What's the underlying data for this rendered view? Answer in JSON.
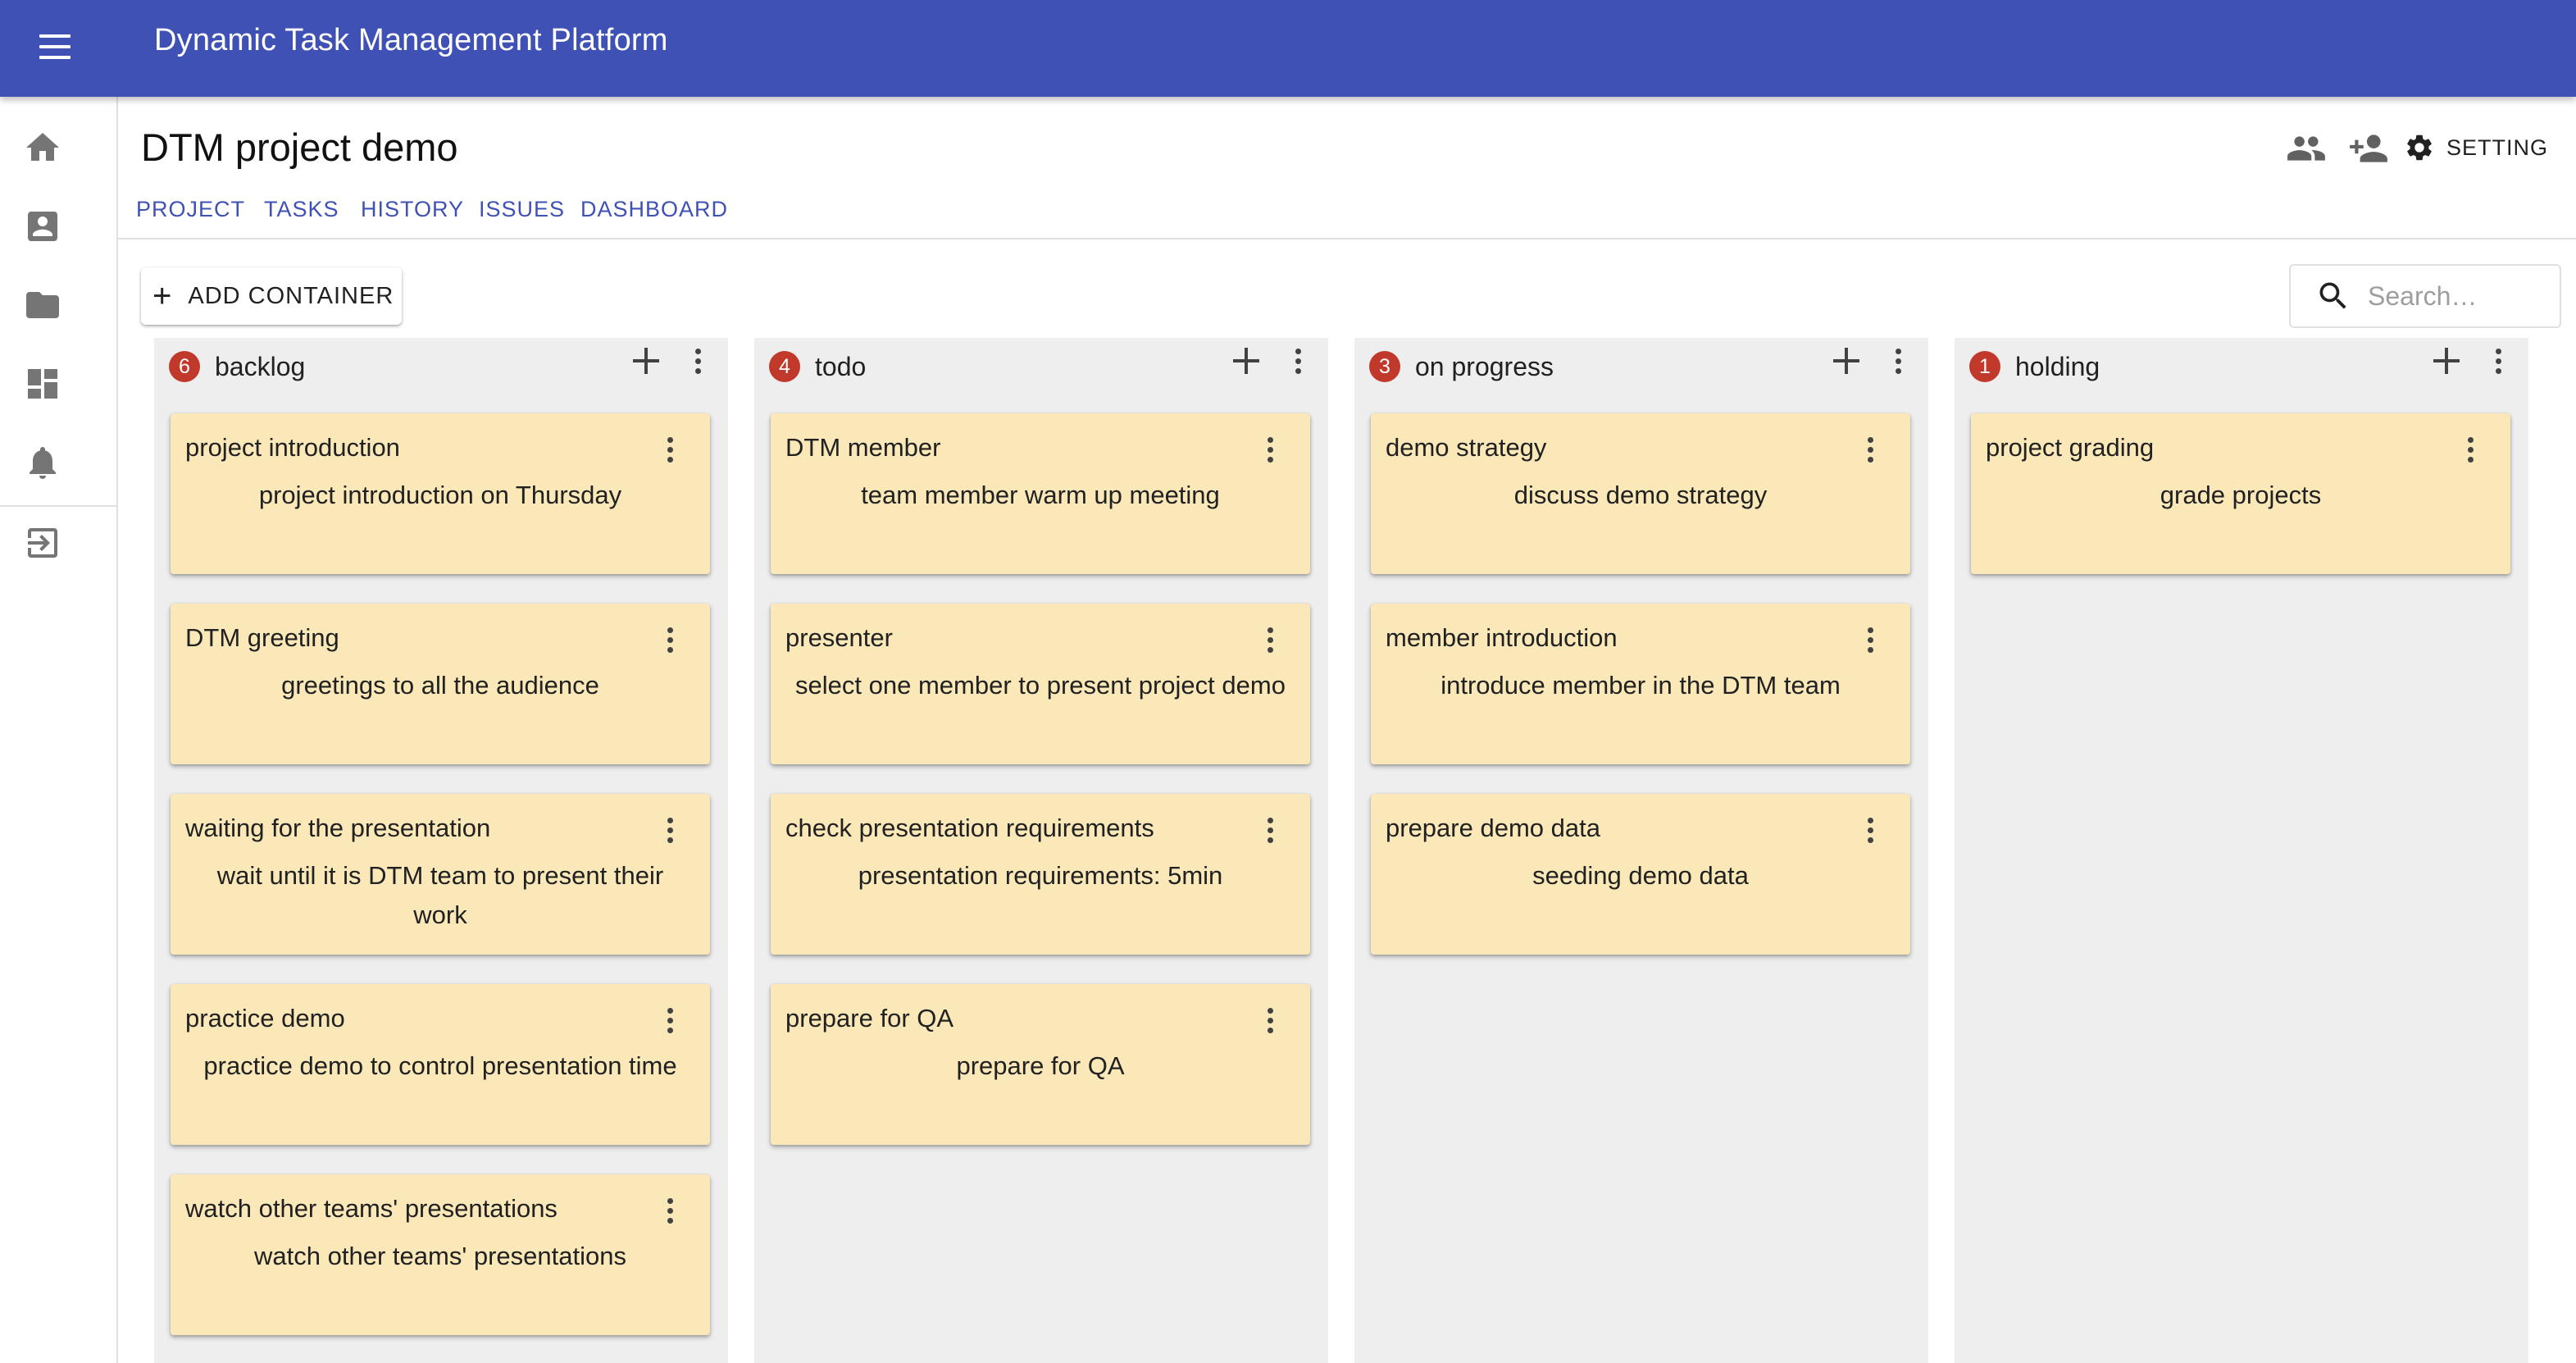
{
  "app": {
    "title": "Dynamic Task Management Platform"
  },
  "sidebar": {
    "items": [
      "home-icon",
      "account-box-icon",
      "folder-icon",
      "dashboard-icon",
      "notifications-icon",
      "logout-icon"
    ]
  },
  "project": {
    "title": "DTM project demo"
  },
  "tabs": [
    {
      "label": "PROJECT"
    },
    {
      "label": "TASKS"
    },
    {
      "label": "HISTORY"
    },
    {
      "label": "ISSUES"
    },
    {
      "label": "DASHBOARD"
    }
  ],
  "header_actions": {
    "setting_label": "SETTING"
  },
  "toolbar": {
    "add_container_label": "ADD CONTAINER"
  },
  "search": {
    "placeholder": "Search…"
  },
  "colors": {
    "appbar": "#3f51b5",
    "card": "#fae8b9",
    "badge": "#c0392b",
    "column": "#eeeeee"
  },
  "columns": [
    {
      "title": "backlog",
      "count": "6",
      "cards": [
        {
          "title": "project introduction",
          "desc": "project introduction on Thursday"
        },
        {
          "title": "DTM greeting",
          "desc": "greetings to all the audience"
        },
        {
          "title": "waiting for the presentation",
          "desc": "wait until it is DTM team to present their work"
        },
        {
          "title": "practice demo",
          "desc": "practice demo to control presentation time"
        },
        {
          "title": "watch other teams' presentations",
          "desc": "watch other teams' presentations"
        }
      ]
    },
    {
      "title": "todo",
      "count": "4",
      "cards": [
        {
          "title": "DTM member",
          "desc": "team member warm up meeting"
        },
        {
          "title": "presenter",
          "desc": "select one member to present project demo"
        },
        {
          "title": "check presentation requirements",
          "desc": "presentation requirements: 5min"
        },
        {
          "title": "prepare for QA",
          "desc": "prepare for QA"
        }
      ]
    },
    {
      "title": "on progress",
      "count": "3",
      "cards": [
        {
          "title": "demo strategy",
          "desc": "discuss demo strategy"
        },
        {
          "title": "member introduction",
          "desc": "introduce member in the DTM team"
        },
        {
          "title": "prepare demo data",
          "desc": "seeding demo data"
        }
      ]
    },
    {
      "title": "holding",
      "count": "1",
      "cards": [
        {
          "title": "project grading",
          "desc": "grade projects"
        }
      ]
    }
  ]
}
